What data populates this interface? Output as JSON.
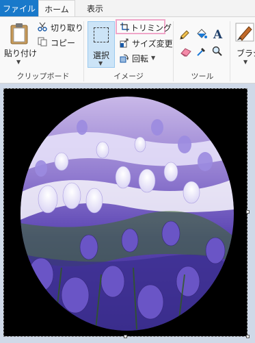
{
  "tabs": {
    "file": "ファイル",
    "home": "ホーム",
    "view": "表示"
  },
  "clipboard": {
    "paste": "貼り付け",
    "cut": "切り取り",
    "copy": "コピー",
    "group": "クリップボード"
  },
  "image": {
    "select": "選択",
    "crop": "トリミング",
    "resize": "サイズ変更",
    "rotate": "回転",
    "group": "イメージ"
  },
  "tools": {
    "group": "ツール"
  },
  "brush": {
    "label": "ブラシ"
  },
  "colors": {
    "file_tab": "#1979ca",
    "selected_button": "#cce4f7",
    "crop_highlight": "#f0a6c9",
    "canvas_bg": "#000000",
    "workspace": "#cfd9e8"
  }
}
